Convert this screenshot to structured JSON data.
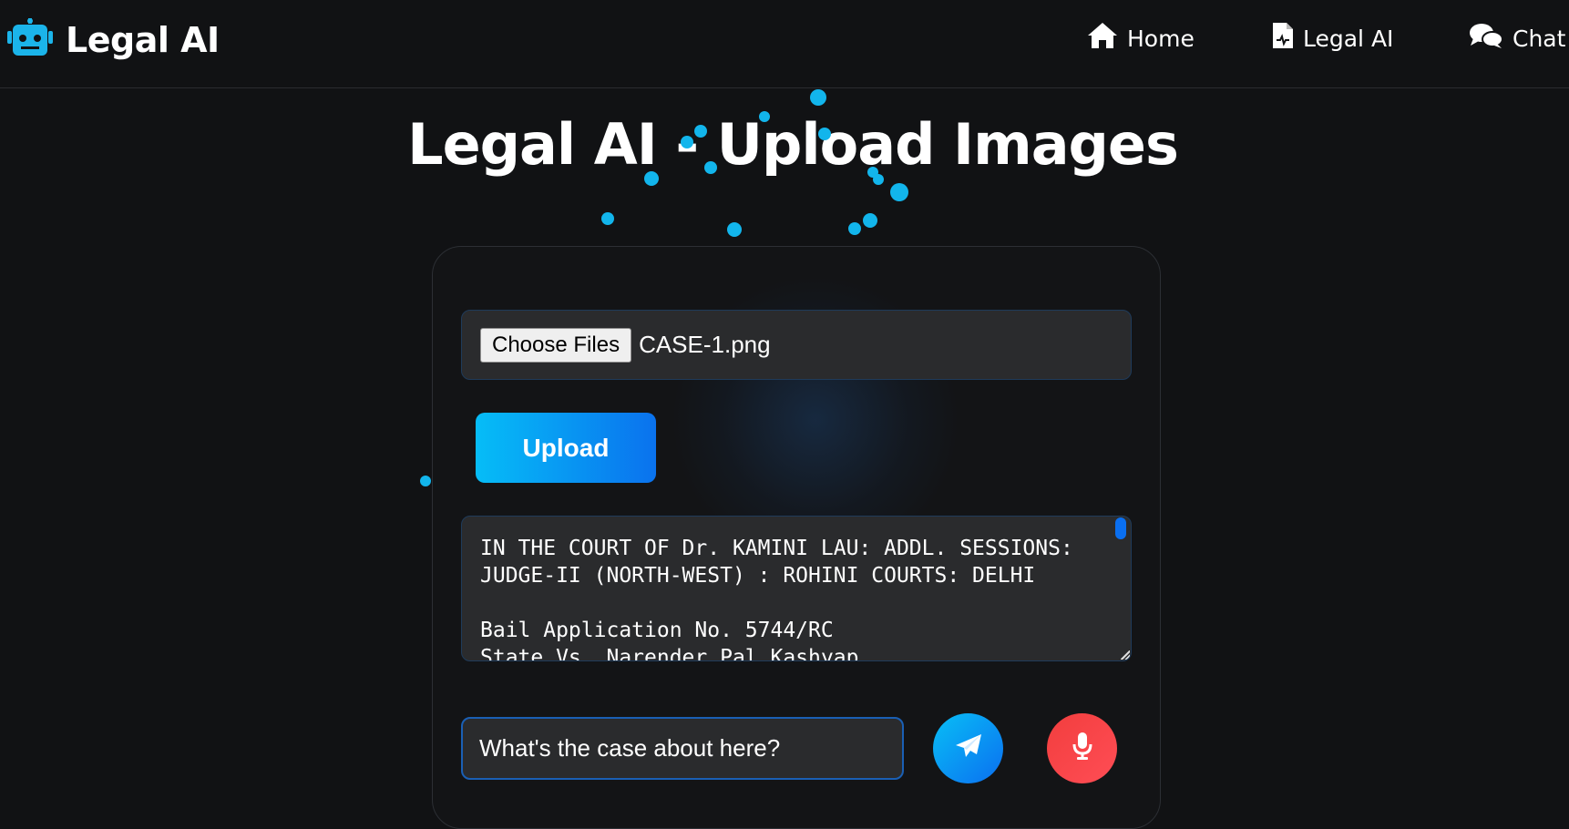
{
  "navbar": {
    "brand": "Legal AI",
    "brand_icon": "robot-icon",
    "items": [
      {
        "label": "Home",
        "icon": "home-icon"
      },
      {
        "label": "Legal AI",
        "icon": "document-icon"
      },
      {
        "label": "Chat",
        "icon": "chat-bubbles-icon"
      }
    ]
  },
  "page": {
    "title": "Legal AI - Upload Images"
  },
  "upload": {
    "choose_label": "Choose Files",
    "file_name": "CASE-1.png",
    "button_label": "Upload"
  },
  "extracted_text": "IN THE COURT OF Dr. KAMINI LAU: ADDL. SESSIONS:\nJUDGE-II (NORTH-WEST) : ROHINI COURTS: DELHI\n\nBail Application No. 5744/RC\nState Vs. Narender Pal Kashyap",
  "question": {
    "value": "What's the case about here?"
  },
  "colors": {
    "accent": "#0a72ee",
    "accent_light": "#06bdf7",
    "mic": "#f23e3e",
    "background": "#111214",
    "panel": "#2a2b2d"
  }
}
